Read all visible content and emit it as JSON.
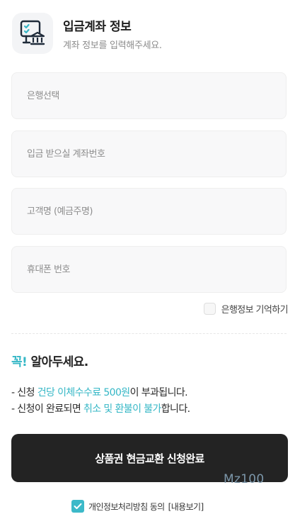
{
  "header": {
    "icon": "bank-account-icon",
    "title": "입금계좌 정보",
    "subtitle": "계좌 정보를 입력해주세요."
  },
  "form": {
    "bank_placeholder": "은행선택",
    "account_placeholder": "입금 받으실 계좌번호",
    "name_placeholder": "고객명 (예금주명)",
    "phone_placeholder": "휴대폰 번호",
    "remember_label": "은행정보 기억하기",
    "remember_checked": false
  },
  "notice": {
    "title_accent": "꼭!",
    "title_rest": " 알아두세요.",
    "line1_prefix": "- 신청 ",
    "line1_accent": "건당 이체수수료 500원",
    "line1_suffix": "이 부과됩니다.",
    "line2_prefix": "- 신청이 완료되면 ",
    "line2_accent": "취소 및 환불이 불가",
    "line2_suffix": "합니다."
  },
  "submit": {
    "label": "상품권 현금교환 신청완료"
  },
  "watermark": "Mz100",
  "agreement": {
    "checked": true,
    "label": "개인정보처리방침 동의",
    "link": "[내용보기]"
  },
  "colors": {
    "accent": "#35b7c6",
    "button": "#232323",
    "checkbox": "#3cb9c9"
  }
}
